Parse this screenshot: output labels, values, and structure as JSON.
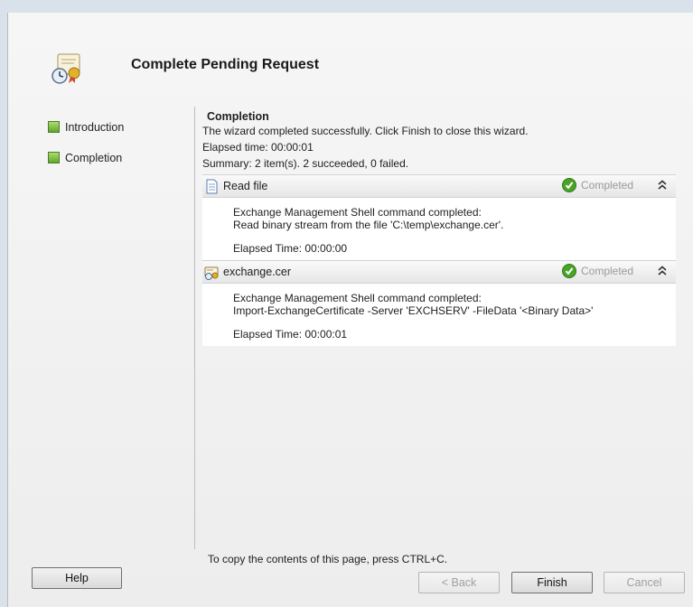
{
  "header": {
    "title": "Complete Pending Request"
  },
  "nav": {
    "items": [
      {
        "label": "Introduction"
      },
      {
        "label": "Completion"
      }
    ]
  },
  "completion": {
    "title": "Completion",
    "message": "The wizard completed successfully. Click Finish to close this wizard.",
    "elapsed": "Elapsed time: 00:00:01",
    "summary": "Summary: 2 item(s). 2 succeeded, 0 failed."
  },
  "tasks": [
    {
      "name": "Read file",
      "icon": "file-icon",
      "status": "Completed",
      "line1": "Exchange Management Shell command completed:",
      "line2": "Read binary stream from the file 'C:\\temp\\exchange.cer'.",
      "elapsed": "Elapsed Time: 00:00:00"
    },
    {
      "name": "exchange.cer",
      "icon": "certificate-icon",
      "status": "Completed",
      "line1": "Exchange Management Shell command completed:",
      "line2": "Import-ExchangeCertificate -Server 'EXCHSERV' -FileData '<Binary Data>'",
      "elapsed": "Elapsed Time: 00:00:01"
    }
  ],
  "footer": {
    "copy_hint": "To copy the contents of this page, press CTRL+C.",
    "help": "Help",
    "back": "< Back",
    "finish": "Finish",
    "cancel": "Cancel"
  },
  "colors": {
    "status_green": "#4aa329",
    "status_text": "#9a9a9a",
    "nav_green": "#5fa72e"
  }
}
